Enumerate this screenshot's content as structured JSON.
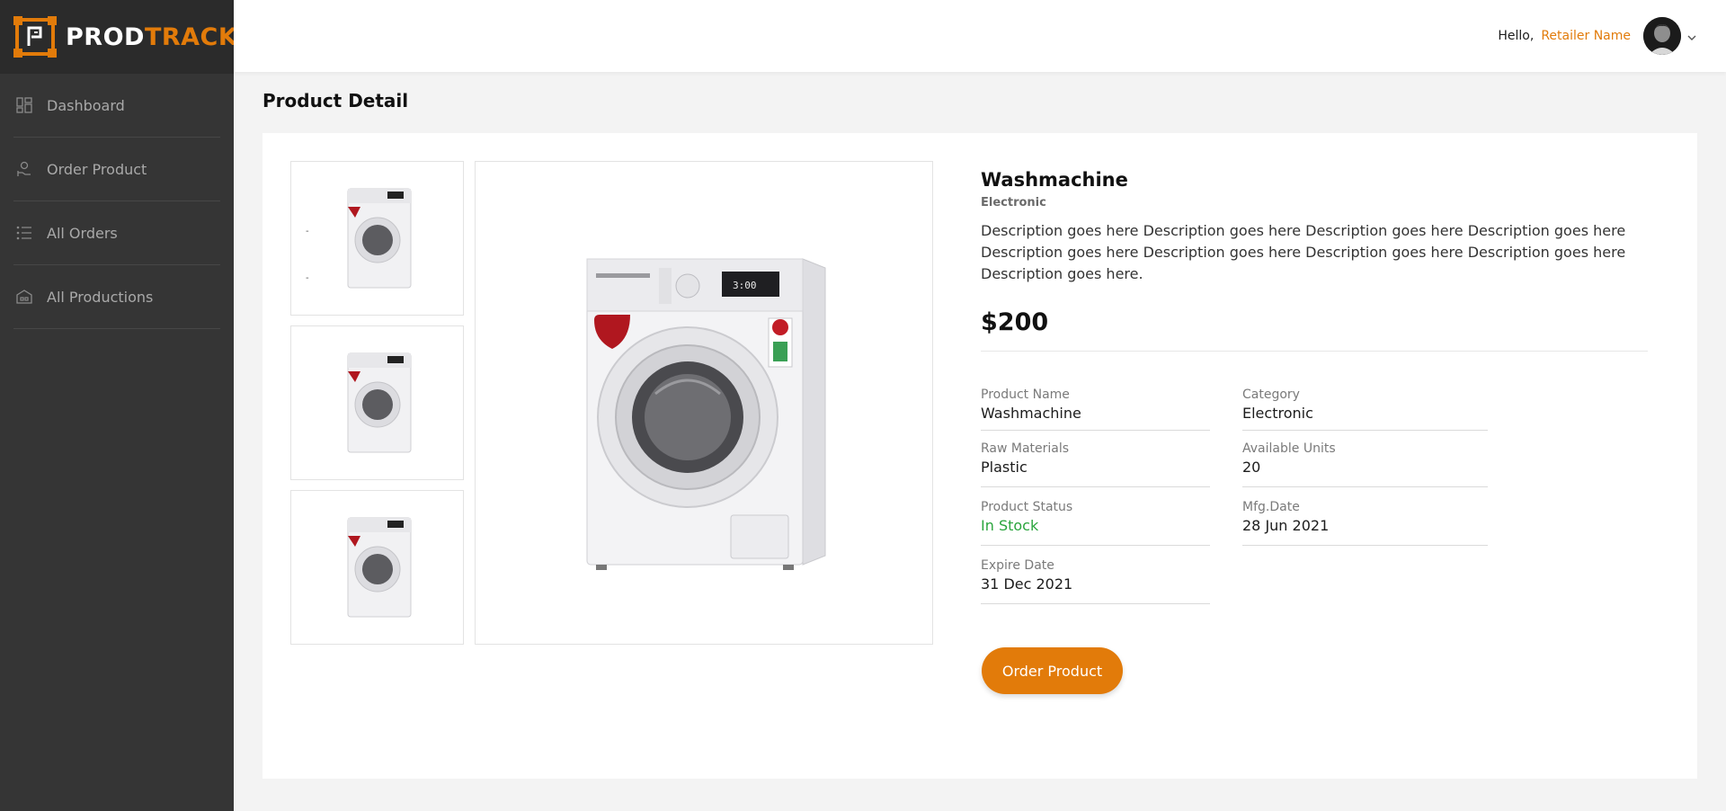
{
  "brand": {
    "part1": "PROD",
    "part2": "TRACK",
    "accent_color": "#e27b0a"
  },
  "sidebar": {
    "items": [
      {
        "label": "Dashboard",
        "icon": "dashboard-icon"
      },
      {
        "label": "Order Product",
        "icon": "order-hand-icon"
      },
      {
        "label": "All Orders",
        "icon": "list-icon"
      },
      {
        "label": "All Productions",
        "icon": "production-icon"
      }
    ]
  },
  "header": {
    "greeting": "Hello,",
    "user_name": "Retailer Name"
  },
  "page": {
    "title": "Product Detail"
  },
  "product": {
    "name": "Washmachine",
    "category": "Electronic",
    "description": "Description goes here Description goes here Description goes here Description goes here Description goes here Description goes here Description goes here Description goes here Description goes here.",
    "price": "$200",
    "image_count": 3
  },
  "details": {
    "product_name": {
      "label": "Product Name",
      "value": "Washmachine"
    },
    "category": {
      "label": "Category",
      "value": "Electronic"
    },
    "raw_materials": {
      "label": "Raw Materials",
      "value": "Plastic"
    },
    "available_units": {
      "label": "Available Units",
      "value": "20"
    },
    "product_status": {
      "label": "Product Status",
      "value": "In Stock",
      "color": "#2aa53d"
    },
    "mfg_date": {
      "label": "Mfg.Date",
      "value": "28 Jun 2021"
    },
    "expire_date": {
      "label": "Expire Date",
      "value": "31 Dec 2021"
    }
  },
  "actions": {
    "order_label": "Order Product"
  }
}
